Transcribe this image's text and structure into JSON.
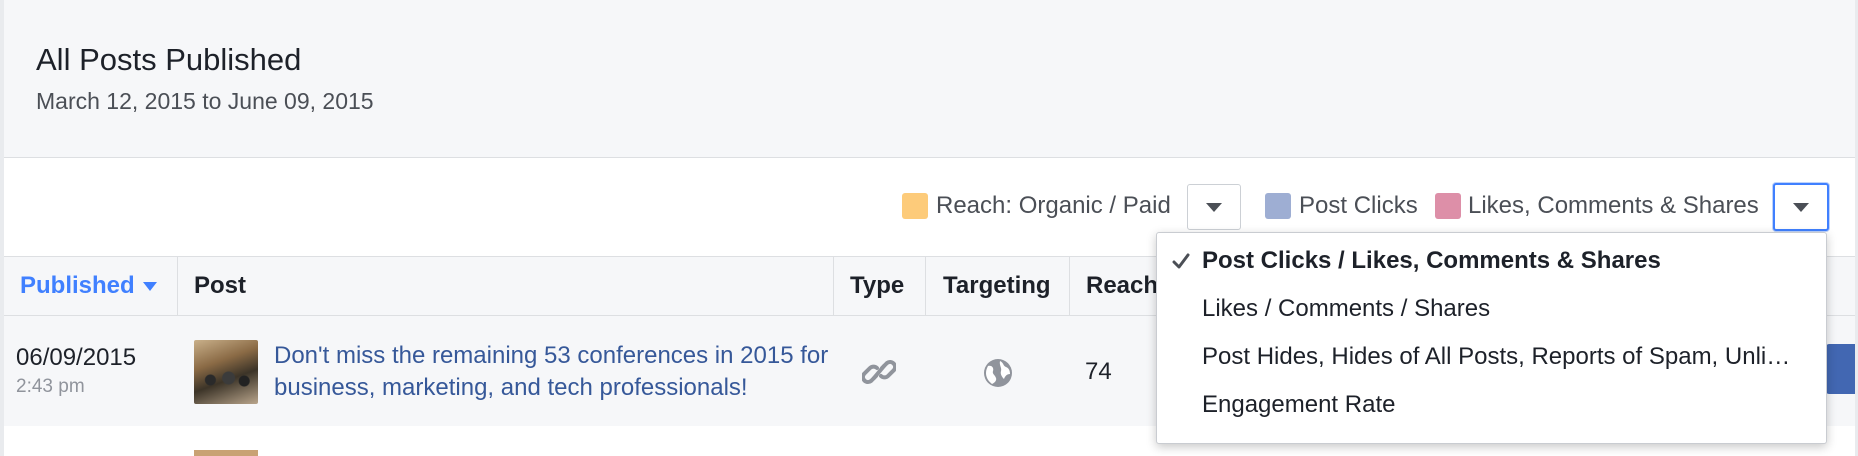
{
  "report": {
    "title": "All Posts Published",
    "date_range": "March 12, 2015 to June 09, 2015"
  },
  "legend": {
    "reach_label": "Reach: Organic / Paid",
    "reach_color": "#fdcb7a",
    "clicks_label": "Post Clicks",
    "clicks_color": "#9eaed3",
    "engagement_label": "Likes, Comments & Shares",
    "engagement_color": "#dd8fa8"
  },
  "table": {
    "columns": [
      "Published",
      "Post",
      "Type",
      "Targeting",
      "Reach"
    ],
    "sorted_column": "Published",
    "rows": [
      {
        "date": "06/09/2015",
        "time": "2:43 pm",
        "post": "Don't miss the remaining 53 conferences in 2015 for business, marketing, and tech professionals!",
        "type_icon": "link-icon",
        "targeting_icon": "globe-icon",
        "reach": "74"
      }
    ]
  },
  "metric_menu": {
    "items": [
      {
        "label": "Post Clicks / Likes, Comments & Shares",
        "selected": true
      },
      {
        "label": "Likes / Comments / Shares",
        "selected": false
      },
      {
        "label": "Post Hides, Hides of All Posts, Reports of Spam, Unli…",
        "selected": false
      },
      {
        "label": "Engagement Rate",
        "selected": false
      }
    ]
  },
  "colors": {
    "accent": "#4080ff",
    "link": "#365899",
    "primary_button": "#4267b2"
  }
}
